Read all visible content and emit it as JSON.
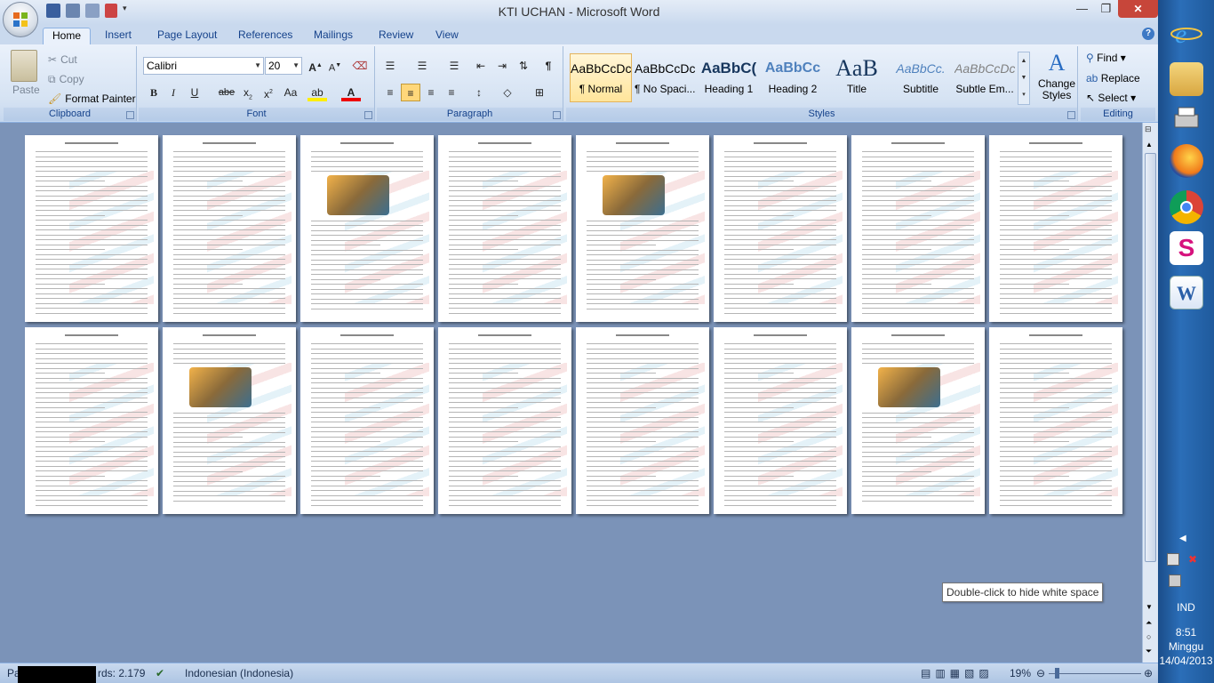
{
  "window": {
    "title": "KTI UCHAN - Microsoft Word"
  },
  "tabs": [
    "Home",
    "Insert",
    "Page Layout",
    "References",
    "Mailings",
    "Review",
    "View"
  ],
  "clipboard": {
    "paste": "Paste",
    "cut": "Cut",
    "copy": "Copy",
    "format_painter": "Format Painter",
    "label": "Clipboard"
  },
  "font": {
    "family": "Calibri",
    "size": "20",
    "label": "Font"
  },
  "paragraph": {
    "label": "Paragraph"
  },
  "styles": {
    "label": "Styles",
    "items": [
      {
        "sample": "AaBbCcDc",
        "name": "¶ Normal"
      },
      {
        "sample": "AaBbCcDc",
        "name": "¶ No Spaci..."
      },
      {
        "sample": "AaBbC(",
        "name": "Heading 1"
      },
      {
        "sample": "AaBbCc",
        "name": "Heading 2"
      },
      {
        "sample": "AaB",
        "name": "Title"
      },
      {
        "sample": "AaBbCc.",
        "name": "Subtitle"
      },
      {
        "sample": "AaBbCcDc",
        "name": "Subtle Em..."
      }
    ],
    "change": "Change Styles"
  },
  "editing": {
    "find": "Find",
    "replace": "Replace",
    "select": "Select",
    "label": "Editing"
  },
  "tooltip": "Double-click to hide white space",
  "status": {
    "page": "Pa",
    "words": "rds: 2.179",
    "language": "Indonesian (Indonesia)",
    "zoom": "19%"
  },
  "tray": {
    "lang": "IND",
    "time": "8:51",
    "day": "Minggu",
    "date": "14/04/2013"
  },
  "colors": {
    "ribbon": "#dbe7f5",
    "doc_bg": "#7b93b8",
    "taskbar": "#2b6eb8",
    "accent": "#15428b"
  }
}
